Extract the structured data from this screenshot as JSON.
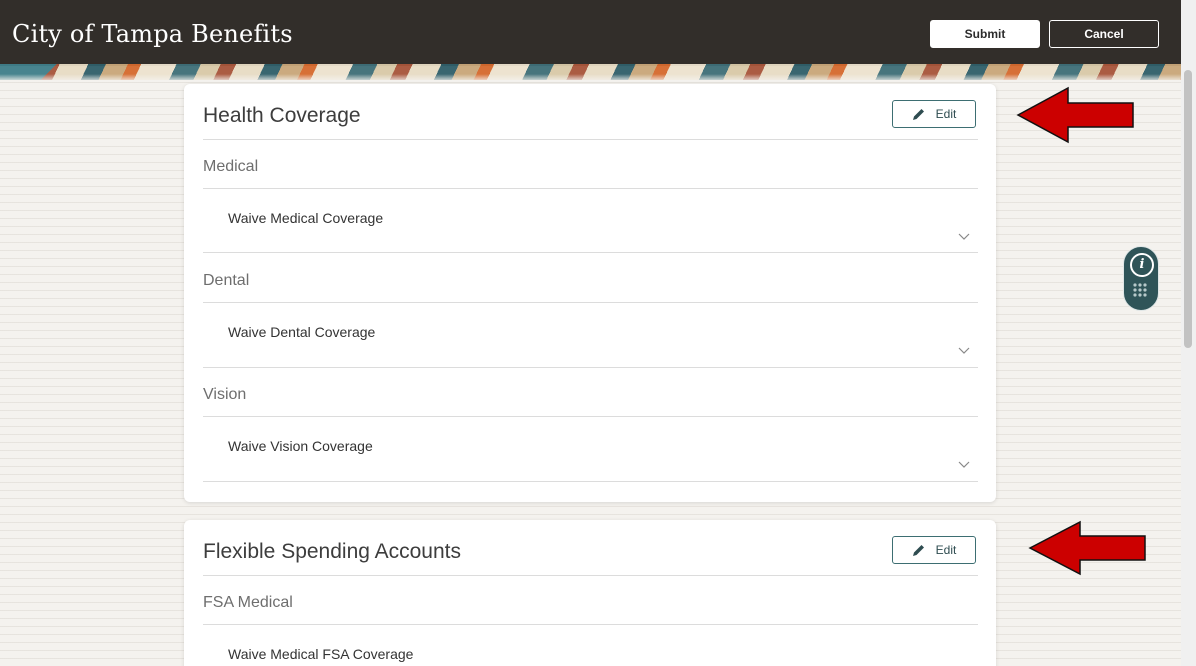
{
  "header": {
    "title": "City of Tampa Benefits",
    "submit_label": "Submit",
    "cancel_label": "Cancel"
  },
  "cards": [
    {
      "title": "Health Coverage",
      "edit_label": "Edit",
      "sections": [
        {
          "label": "Medical",
          "value": "Waive Medical Coverage"
        },
        {
          "label": "Dental",
          "value": "Waive Dental Coverage"
        },
        {
          "label": "Vision",
          "value": "Waive Vision Coverage"
        }
      ]
    },
    {
      "title": "Flexible Spending Accounts",
      "edit_label": "Edit",
      "sections": [
        {
          "label": "FSA Medical",
          "value": "Waive Medical FSA Coverage"
        }
      ]
    }
  ],
  "colors": {
    "header_bg": "#322e2a",
    "accent_teal": "#2f5458",
    "annotation_arrow": "#cc0000"
  },
  "icons": {
    "edit": "pencil-icon",
    "expand": "chevron-down-icon",
    "info": "info-icon",
    "apps": "dots-grid-icon"
  }
}
